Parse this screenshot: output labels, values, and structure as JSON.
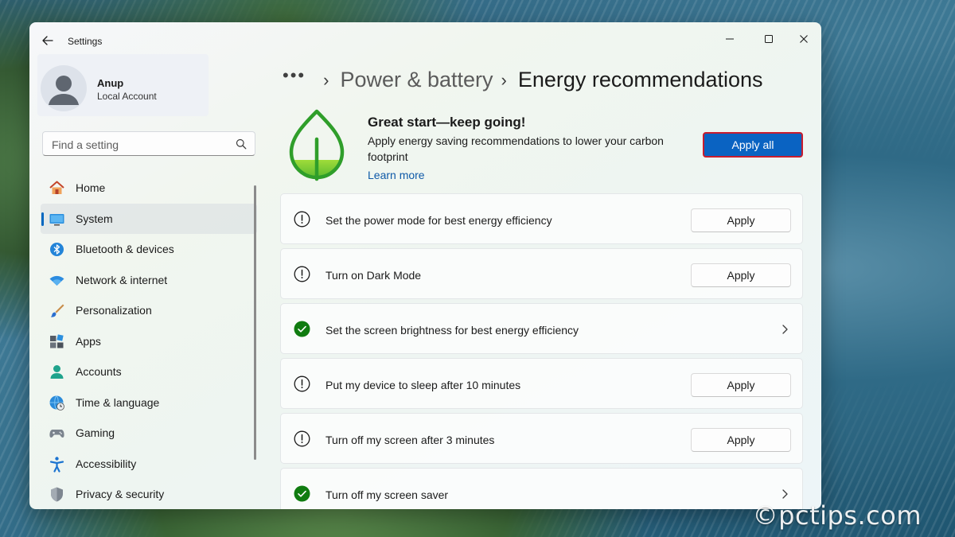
{
  "window": {
    "title": "Settings"
  },
  "profile": {
    "name": "Anup",
    "account_type": "Local Account"
  },
  "search": {
    "placeholder": "Find a setting"
  },
  "sidebar": {
    "items": [
      {
        "label": "Home",
        "icon": "home-icon",
        "selected": false
      },
      {
        "label": "System",
        "icon": "system-icon",
        "selected": true
      },
      {
        "label": "Bluetooth & devices",
        "icon": "bluetooth-icon",
        "selected": false
      },
      {
        "label": "Network & internet",
        "icon": "wifi-icon",
        "selected": false
      },
      {
        "label": "Personalization",
        "icon": "brush-icon",
        "selected": false
      },
      {
        "label": "Apps",
        "icon": "apps-icon",
        "selected": false
      },
      {
        "label": "Accounts",
        "icon": "accounts-icon",
        "selected": false
      },
      {
        "label": "Time & language",
        "icon": "globe-clock-icon",
        "selected": false
      },
      {
        "label": "Gaming",
        "icon": "gamepad-icon",
        "selected": false
      },
      {
        "label": "Accessibility",
        "icon": "accessibility-icon",
        "selected": false
      },
      {
        "label": "Privacy & security",
        "icon": "shield-icon",
        "selected": false
      }
    ]
  },
  "breadcrumb": {
    "more": "•••",
    "separator": "›",
    "parent": "Power & battery",
    "current": "Energy recommendations"
  },
  "hero": {
    "icon": "leaf-icon",
    "title": "Great start—keep going!",
    "description": "Apply energy saving recommendations to lower your carbon footprint",
    "link": "Learn more",
    "apply_all_label": "Apply all"
  },
  "recommendations": [
    {
      "label": "Set the power mode for best energy efficiency",
      "status": "pending",
      "action": "Apply"
    },
    {
      "label": "Turn on Dark Mode",
      "status": "pending",
      "action": "Apply"
    },
    {
      "label": "Set the screen brightness for best energy efficiency",
      "status": "done",
      "action": ""
    },
    {
      "label": "Put my device to sleep after 10 minutes",
      "status": "pending",
      "action": "Apply"
    },
    {
      "label": "Turn off my screen after 3 minutes",
      "status": "pending",
      "action": "Apply"
    },
    {
      "label": "Turn off my screen saver",
      "status": "done",
      "action": ""
    }
  ],
  "watermark": "©pctips.com",
  "colors": {
    "accent": "#0a63c2",
    "success": "#107c10",
    "focus_border": "#c81c2e"
  }
}
